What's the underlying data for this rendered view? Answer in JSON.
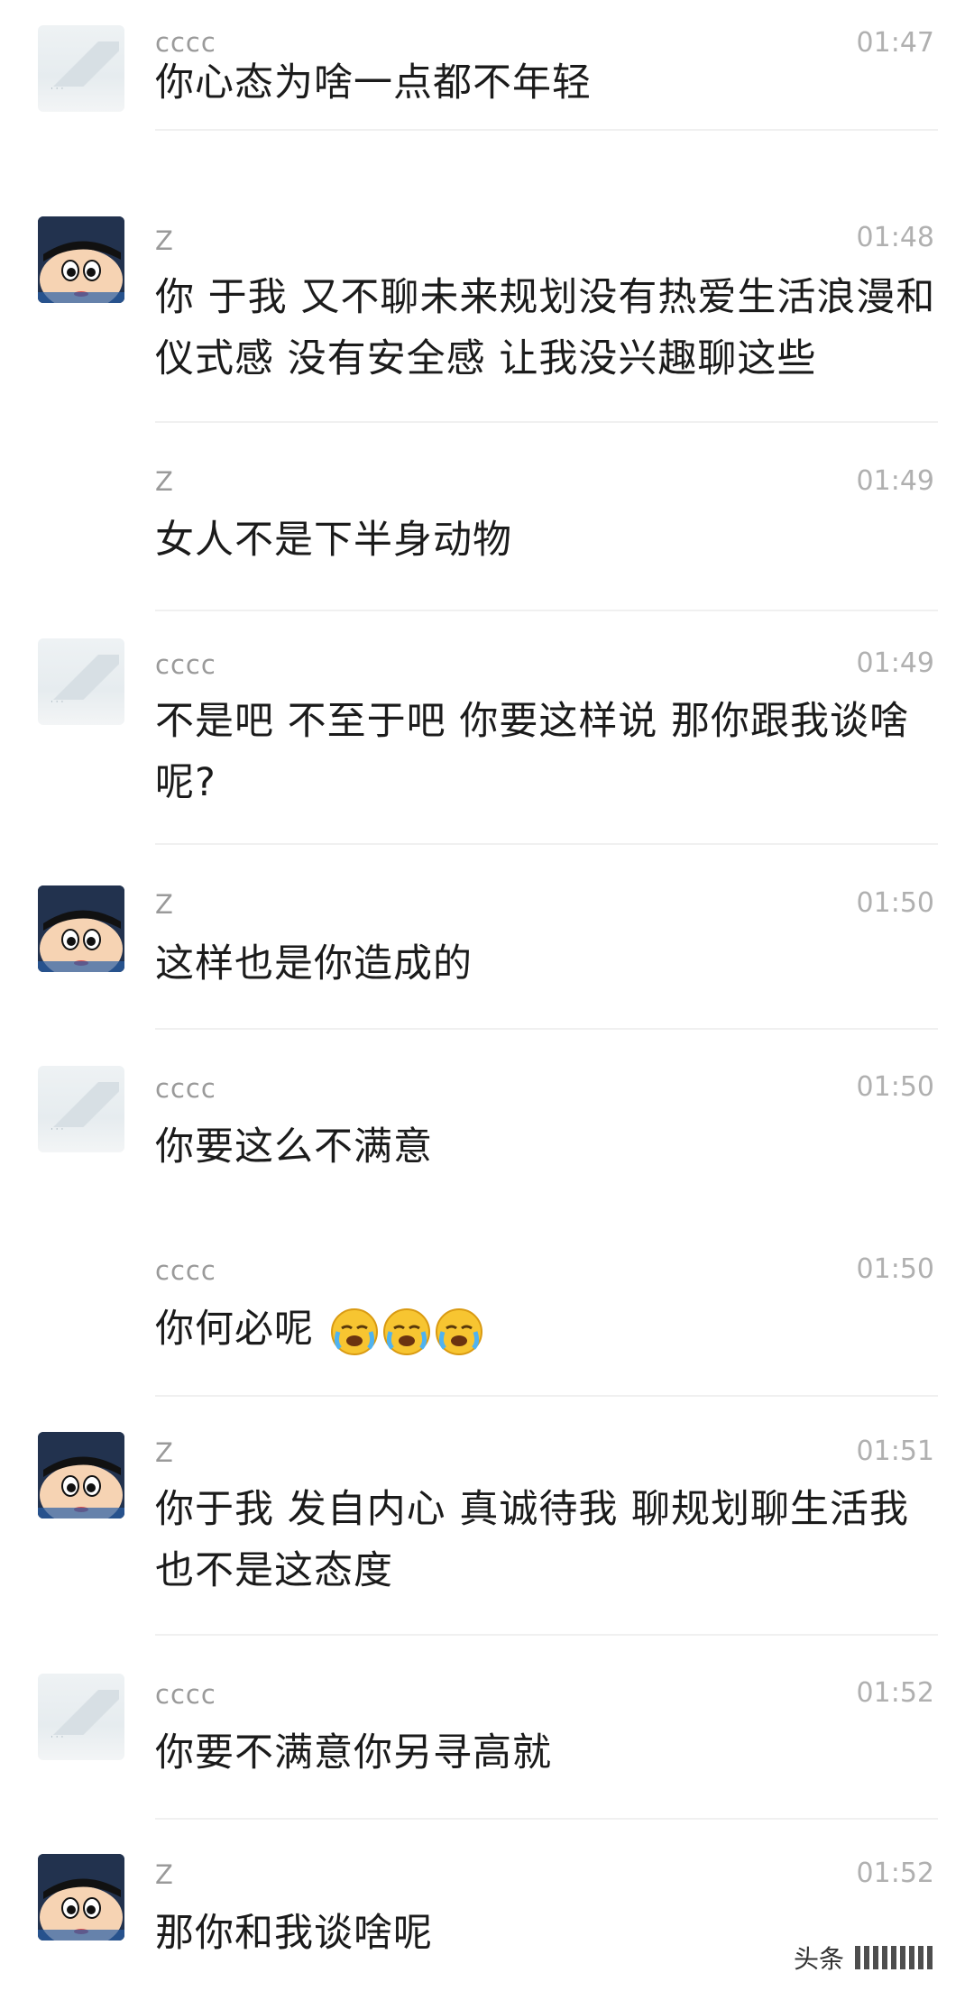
{
  "messages": [
    {
      "sender": "cccc",
      "time": "01:47",
      "text": "你心态为啥一点都不年轻",
      "avatar": "landscape"
    },
    {
      "sender": "Z",
      "time": "01:48",
      "text": "你 于我 又不聊未来规划没有热爱生活浪漫和仪式感 没有安全感 让我没兴趣聊这些",
      "avatar": "shinchan"
    },
    {
      "sender": "Z",
      "time": "01:49",
      "text": "女人不是下半身动物",
      "avatar": ""
    },
    {
      "sender": "cccc",
      "time": "01:49",
      "text": "不是吧 不至于吧 你要这样说 那你跟我谈啥呢?",
      "avatar": "landscape"
    },
    {
      "sender": "Z",
      "time": "01:50",
      "text": "这样也是你造成的",
      "avatar": "shinchan"
    },
    {
      "sender": "cccc",
      "time": "01:50",
      "text": "你要这么不满意",
      "avatar": "landscape"
    },
    {
      "sender": "cccc",
      "time": "01:50",
      "text": "你何必呢",
      "avatar": "",
      "emojis": [
        "crying-face-icon",
        "crying-face-icon",
        "crying-face-icon"
      ]
    },
    {
      "sender": "Z",
      "time": "01:51",
      "text": "你于我 发自内心 真诚待我 聊规划聊生活我也不是这态度",
      "avatar": "shinchan"
    },
    {
      "sender": "cccc",
      "time": "01:52",
      "text": "你要不满意你另寻高就",
      "avatar": "landscape"
    },
    {
      "sender": "Z",
      "time": "01:52",
      "text": "那你和我谈啥呢",
      "avatar": "shinchan"
    }
  ],
  "watermark": {
    "label": "头条"
  },
  "colors": {
    "name": "#9a9a9a",
    "time": "#b0b0b0",
    "text": "#1b1b1b",
    "divider": "#f0f0f0"
  }
}
